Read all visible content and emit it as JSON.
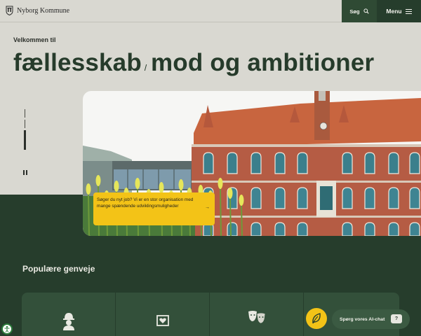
{
  "header": {
    "logo_text": "Nyborg Kommune",
    "search_label": "Søg",
    "menu_label": "Menu"
  },
  "hero": {
    "welcome": "Velkommen til",
    "headline_part1": "fællesskab",
    "headline_part2": "mod og ambitioner",
    "carousel": {
      "slides": 3,
      "active_slide": 2,
      "state": "playing"
    },
    "job_card": {
      "text": "Søger du nyt job? Vi er en stor organisation med mange spændende udviklingsmuligheder",
      "arrow": "→"
    }
  },
  "shortcuts": {
    "title": "Populære genveje",
    "items": [
      {
        "icon": "worker-icon"
      },
      {
        "icon": "heart-frame-icon"
      },
      {
        "icon": "theater-masks-icon"
      },
      {
        "icon": "leaf-icon"
      }
    ]
  },
  "ai_chat": {
    "label": "Spørg vores AI-chat",
    "icon_text": "?"
  },
  "colors": {
    "dark_green": "#263d2c",
    "card_green": "#33503a",
    "yellow": "#f3c317",
    "background": "#d9d8d1"
  }
}
